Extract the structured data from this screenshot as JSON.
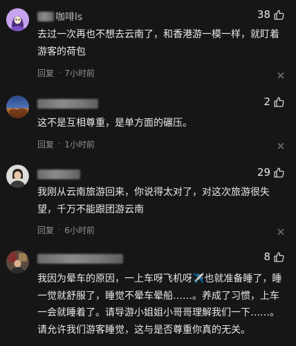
{
  "comments": [
    {
      "username": "咖啡ls",
      "likes": "38",
      "text": "去过一次再也不想去云南了，和香港游一模一样，就盯着游客的荷包",
      "reply_label": "回复",
      "time": "7小时前"
    },
    {
      "username": "",
      "likes": "2",
      "text": "这不是互相尊重，是单方面的碾压。",
      "reply_label": "回复",
      "time": "1小时前"
    },
    {
      "username": "",
      "likes": "29",
      "text": "我刚从云南旅游回来，你说得太对了，对这次旅游很失望，千万不能跟团游云南",
      "reply_label": "回复",
      "time": "6小时前"
    },
    {
      "username": "",
      "likes": "8",
      "text": "我因为晕车的原因，一上车呀飞机呀✈️也就准备睡了，睡一觉就舒服了，睡觉不晕车晕船……。养成了习惯，上车一会就睡着了。请导游小姐姐小哥哥理解我们一下……。请允许我们游客睡觉，这与是否尊重你真的无关。",
      "reply_label": "",
      "time": ""
    }
  ],
  "colors": {
    "background": "#161616",
    "text": "#e8e8e8",
    "meta": "#8f8f8f"
  }
}
